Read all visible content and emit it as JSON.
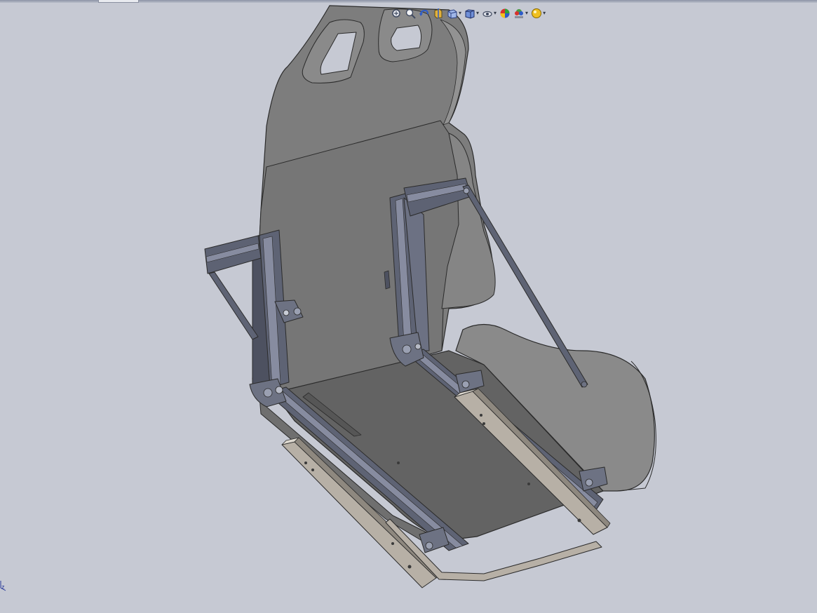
{
  "window": {
    "title": ""
  },
  "heads_up_toolbar": {
    "buttons": [
      {
        "icon": "zoom-to-fit-icon",
        "has_dropdown": false
      },
      {
        "icon": "zoom-to-area-icon",
        "has_dropdown": false
      },
      {
        "icon": "previous-view-icon",
        "has_dropdown": false
      },
      {
        "icon": "section-view-icon",
        "has_dropdown": false
      },
      {
        "icon": "view-orientation-icon",
        "has_dropdown": true
      },
      {
        "icon": "display-style-icon",
        "has_dropdown": true
      },
      {
        "icon": "hide-show-items-icon",
        "has_dropdown": true
      },
      {
        "icon": "edit-appearance-icon",
        "has_dropdown": false
      },
      {
        "icon": "apply-scene-icon",
        "has_dropdown": true
      },
      {
        "icon": "view-settings-icon",
        "has_dropdown": true
      }
    ],
    "dropdown_glyph": "▾"
  },
  "triad": {
    "axis_label": "z"
  },
  "colors": {
    "background": "#c6c9d3",
    "seat_shell": "#7c7c7c",
    "seat_dark": "#646464",
    "extrusion": "#5a5f70",
    "rail": "#b7b0a6"
  }
}
